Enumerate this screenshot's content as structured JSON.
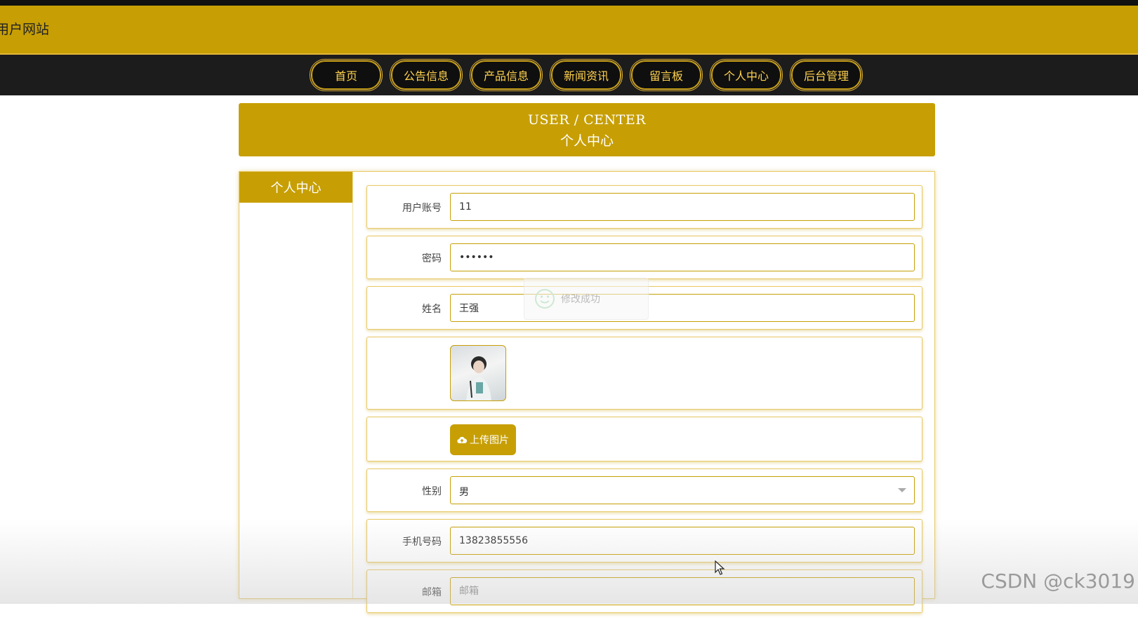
{
  "header": {
    "site_title": "用户网站"
  },
  "nav": {
    "items": [
      "首页",
      "公告信息",
      "产品信息",
      "新闻资讯",
      "留言板",
      "个人中心",
      "后台管理"
    ]
  },
  "banner": {
    "title_en": "USER / CENTER",
    "title_cn": "个人中心"
  },
  "sidebar": {
    "heading": "个人中心"
  },
  "form": {
    "account": {
      "label": "用户账号",
      "value": "11"
    },
    "password": {
      "label": "密码",
      "value": "••••••"
    },
    "name": {
      "label": "姓名",
      "value": "王强"
    },
    "upload_button": "上传图片",
    "gender": {
      "label": "性别",
      "value": "男"
    },
    "phone": {
      "label": "手机号码",
      "value": "13823855556"
    },
    "email": {
      "label": "邮箱",
      "placeholder": "邮箱"
    }
  },
  "toast": {
    "message": "修改成功"
  },
  "watermark": "CSDN @ck3019",
  "colors": {
    "accent": "#c79f05",
    "nav_bg": "#1c1c1c",
    "nav_text": "#ffd24d"
  },
  "icons": {
    "upload": "cloud-upload-icon",
    "toast": "smile-icon",
    "select": "chevron-down-icon",
    "cursor": "mouse-pointer-icon"
  }
}
